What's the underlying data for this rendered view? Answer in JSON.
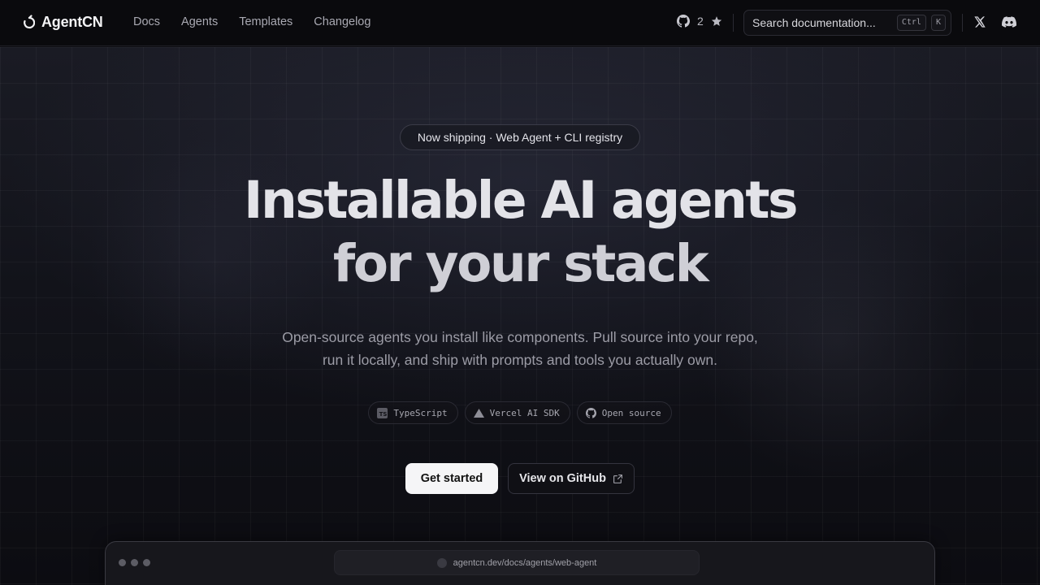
{
  "brand": {
    "name": "AgentCN"
  },
  "nav": {
    "links": [
      "Docs",
      "Agents",
      "Templates",
      "Changelog"
    ],
    "github_stars": "2",
    "search": {
      "placeholder": "Search documentation...",
      "kbd_ctrl": "Ctrl",
      "kbd_k": "K"
    }
  },
  "hero": {
    "pill": "Now shipping · Web Agent + CLI registry",
    "headline_line1": "Installable AI agents",
    "headline_line2": "for your stack",
    "subtext": "Open-source agents you install like components. Pull source into your repo, run it locally, and ship with prompts and tools you actually own.",
    "chips": [
      {
        "label": "TypeScript",
        "icon": "typescript-icon"
      },
      {
        "label": "Vercel AI SDK",
        "icon": "vercel-triangle-icon"
      },
      {
        "label": "Open source",
        "icon": "github-icon"
      }
    ],
    "primary_button": "Get started",
    "secondary_button": "View on GitHub"
  },
  "preview": {
    "url": "agentcn.dev/docs/agents/web-agent"
  }
}
